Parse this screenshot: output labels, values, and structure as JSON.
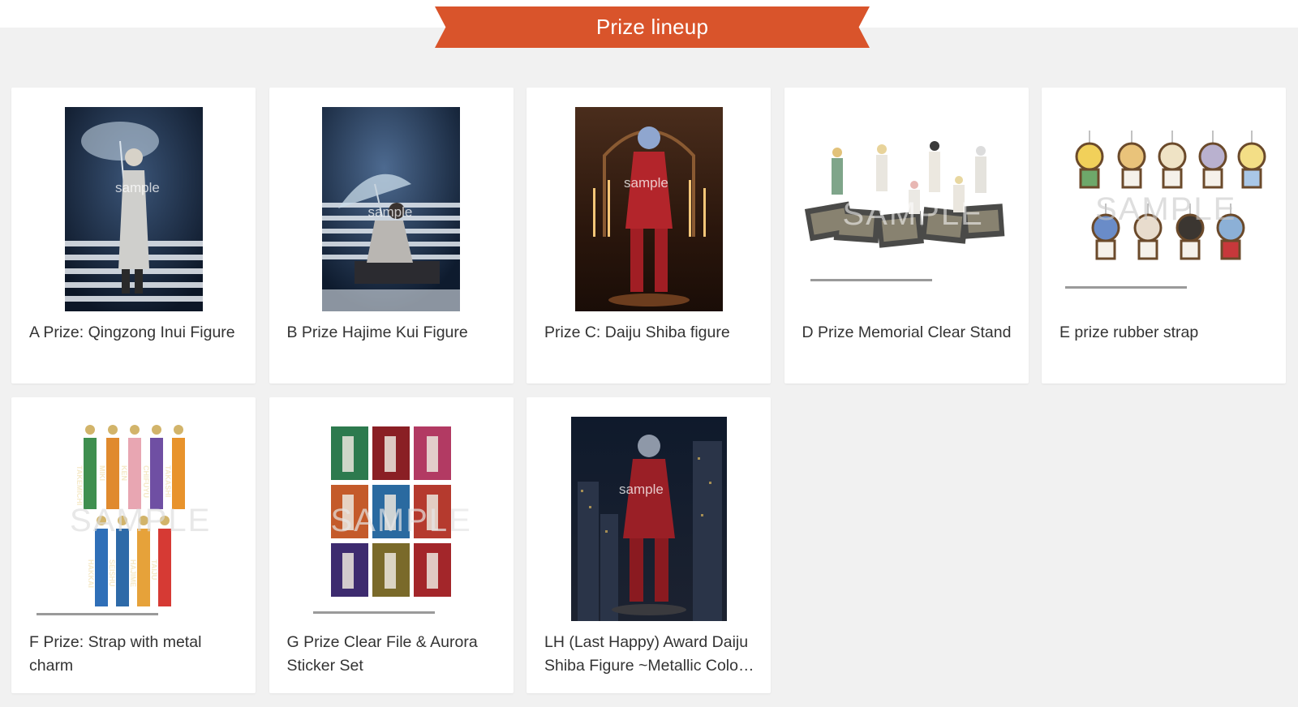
{
  "header": {
    "banner_title": "Prize lineup"
  },
  "prizes": [
    {
      "title": "A Prize: Qingzong Inui Figure",
      "watermark": "sample",
      "image": "figure-umbrella-snow-icon"
    },
    {
      "title": "B Prize Hajime Kui Figure",
      "watermark": "sample",
      "image": "figure-umbrella-sitting-icon"
    },
    {
      "title": "Prize C: Daiju Shiba figure",
      "watermark": "sample",
      "image": "figure-red-coat-icon"
    },
    {
      "title": "D Prize Memorial Clear Stand",
      "watermark": "SAMPLE",
      "image": "clear-stand-set-icon"
    },
    {
      "title": "E prize rubber strap",
      "watermark": "SAMPLE",
      "image": "rubber-strap-set-icon"
    },
    {
      "title": "F Prize: Strap with metal charm",
      "watermark": "SAMPLE",
      "image": "metal-charm-strap-icon",
      "strap_names": [
        "TAKEMICHI",
        "MIKI",
        "KEN",
        "CHIFUYU",
        "TAKASHI",
        "HAKKAI",
        "SEISHU",
        "HAJIME",
        "TAIJU"
      ]
    },
    {
      "title": "G Prize Clear File & Aurora Sticker Set",
      "watermark": "SAMPLE",
      "image": "clear-file-set-icon"
    },
    {
      "title": "LH (Last Happy) Award Daiju Shiba Figure ~Metallic Color ver.~",
      "watermark": "sample",
      "image": "figure-metallic-icon"
    }
  ],
  "colors": {
    "banner": "#d9542b",
    "page_background": "#f1f1f1",
    "card_background": "#ffffff",
    "title_text": "#333333"
  }
}
